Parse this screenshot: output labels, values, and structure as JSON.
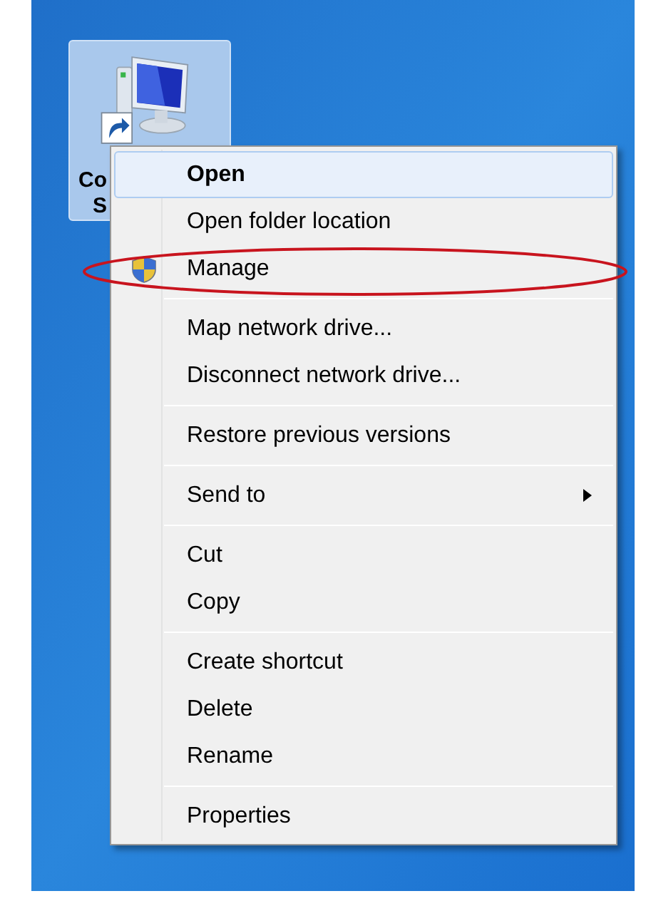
{
  "desktop_icon": {
    "label_lines": [
      "Co",
      "S"
    ],
    "selected": true
  },
  "context_menu": {
    "items": [
      {
        "kind": "item",
        "label": "Open",
        "bold": true,
        "highlighted": true,
        "shield": false,
        "submenu": false,
        "circled": false
      },
      {
        "kind": "item",
        "label": "Open folder location",
        "bold": false,
        "highlighted": false,
        "shield": false,
        "submenu": false,
        "circled": false
      },
      {
        "kind": "item",
        "label": "Manage",
        "bold": false,
        "highlighted": false,
        "shield": true,
        "submenu": false,
        "circled": true
      },
      {
        "kind": "separator"
      },
      {
        "kind": "item",
        "label": "Map network drive...",
        "bold": false,
        "highlighted": false,
        "shield": false,
        "submenu": false,
        "circled": false
      },
      {
        "kind": "item",
        "label": "Disconnect network drive...",
        "bold": false,
        "highlighted": false,
        "shield": false,
        "submenu": false,
        "circled": false
      },
      {
        "kind": "separator"
      },
      {
        "kind": "item",
        "label": "Restore previous versions",
        "bold": false,
        "highlighted": false,
        "shield": false,
        "submenu": false,
        "circled": false
      },
      {
        "kind": "separator"
      },
      {
        "kind": "item",
        "label": "Send to",
        "bold": false,
        "highlighted": false,
        "shield": false,
        "submenu": true,
        "circled": false
      },
      {
        "kind": "separator"
      },
      {
        "kind": "item",
        "label": "Cut",
        "bold": false,
        "highlighted": false,
        "shield": false,
        "submenu": false,
        "circled": false
      },
      {
        "kind": "item",
        "label": "Copy",
        "bold": false,
        "highlighted": false,
        "shield": false,
        "submenu": false,
        "circled": false
      },
      {
        "kind": "separator"
      },
      {
        "kind": "item",
        "label": "Create shortcut",
        "bold": false,
        "highlighted": false,
        "shield": false,
        "submenu": false,
        "circled": false
      },
      {
        "kind": "item",
        "label": "Delete",
        "bold": false,
        "highlighted": false,
        "shield": false,
        "submenu": false,
        "circled": false
      },
      {
        "kind": "item",
        "label": "Rename",
        "bold": false,
        "highlighted": false,
        "shield": false,
        "submenu": false,
        "circled": false
      },
      {
        "kind": "separator"
      },
      {
        "kind": "item",
        "label": "Properties",
        "bold": false,
        "highlighted": false,
        "shield": false,
        "submenu": false,
        "circled": false
      }
    ]
  }
}
